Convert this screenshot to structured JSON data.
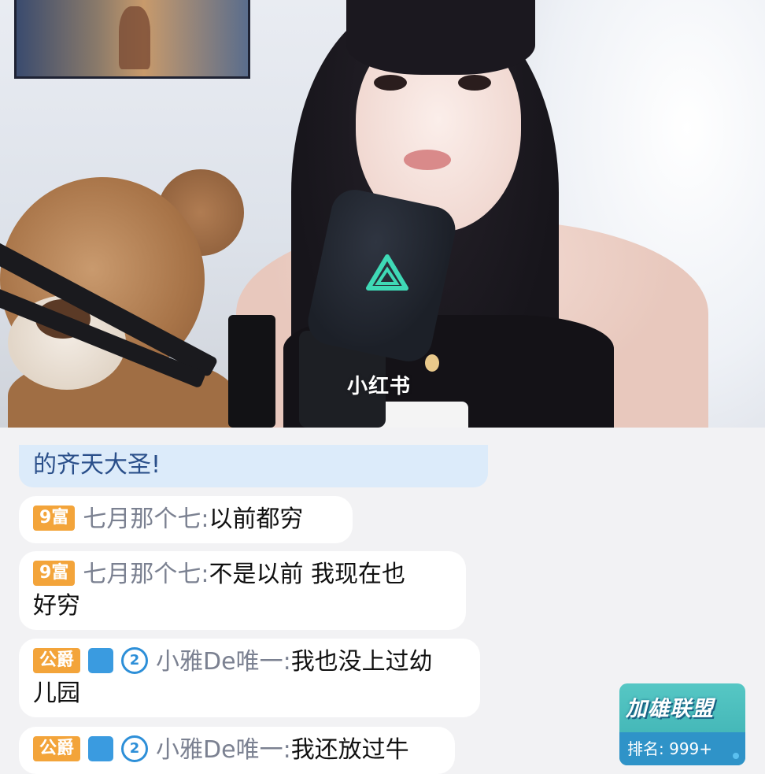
{
  "watermark": "小红书",
  "chat": {
    "messages": [
      {
        "text": "的齐天大圣!"
      },
      {
        "level": "9",
        "badge": "富",
        "user": "七月那个七",
        "sep": ":",
        "text": "以前都穷"
      },
      {
        "level": "9",
        "badge": "富",
        "user": "七月那个七",
        "sep": ":",
        "text_line1": "不是以前 我现在也",
        "text_line2": "好穷"
      },
      {
        "badge": "公爵",
        "icon1": "guard-icon",
        "icon2": "2",
        "user": "小雅De唯一",
        "sep": ":",
        "text_line1": "我也没上过幼",
        "text_line2": "儿园"
      },
      {
        "badge": "公爵",
        "icon1": "guard-icon",
        "icon2": "2",
        "user": "小雅De唯一",
        "sep": ":",
        "text_line1": "我还放过牛"
      }
    ]
  },
  "league_card": {
    "title": "加雄联盟",
    "rank_label": "排名:",
    "rank_value": "999+"
  },
  "colors": {
    "badge_orange": "#f3a43a",
    "username_gray": "#7b8191",
    "highlight_blue": "#dcebfa",
    "league_teal": "#3aaeb1",
    "league_blue": "#2f93c8"
  }
}
